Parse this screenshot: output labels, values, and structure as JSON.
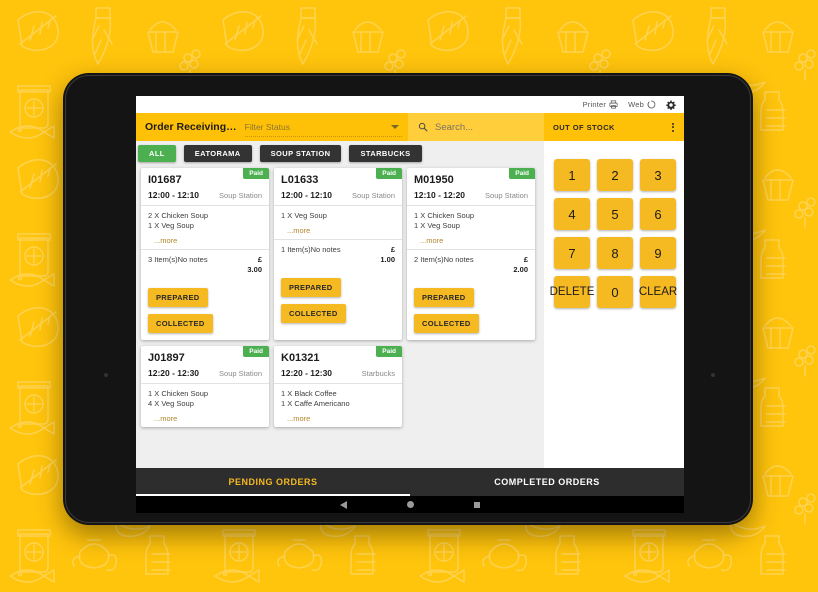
{
  "wallpaper": {
    "bg_color": "#FFC40C",
    "doodle_color": "#FFE08A"
  },
  "device": {
    "frame_color": "#141414"
  },
  "statusbar": {
    "printer_label": "Printer",
    "printer_icon": "printer-icon",
    "web_label": "Web",
    "web_icon": "sync-spinner-icon",
    "settings_icon": "gear-icon"
  },
  "appbar": {
    "title": "Order Receiving…",
    "filter_placeholder": "Filter Status",
    "filter_value": "",
    "dropdown_icon": "chevron-down-icon",
    "accent_color": "#FFC107"
  },
  "search": {
    "placeholder": "Search...",
    "value": "",
    "icon": "search-icon"
  },
  "out_of_stock": {
    "title": "OUT OF STOCK",
    "menu_icon": "kebab-menu-icon",
    "keys": [
      "1",
      "2",
      "3",
      "4",
      "5",
      "6",
      "7",
      "8",
      "9",
      "DELETE",
      "0",
      "CLEAR"
    ],
    "key_color": "#F5B921"
  },
  "filters": {
    "chips": [
      {
        "label": "ALL",
        "active": true
      },
      {
        "label": "EATORAMA",
        "active": false
      },
      {
        "label": "SOUP STATION",
        "active": false
      },
      {
        "label": "STARBUCKS",
        "active": false
      }
    ],
    "active_color": "#4CAF50",
    "inactive_color": "#333333"
  },
  "orders": [
    {
      "id": "I01687",
      "badge": "Paid",
      "time": "12:00 - 12:10",
      "station": "Soup Station",
      "items": [
        "2 X Chicken Soup",
        "1 X Veg Soup"
      ],
      "more_label": "...more",
      "total_note": "3 Item(s)No notes",
      "currency": "£",
      "amount": "3.00",
      "actions": [
        "PREPARED",
        "COLLECTED"
      ]
    },
    {
      "id": "L01633",
      "badge": "Paid",
      "time": "12:00 - 12:10",
      "station": "Soup Station",
      "items": [
        "1 X Veg Soup"
      ],
      "more_label": "...more",
      "total_note": "1 Item(s)No notes",
      "currency": "£",
      "amount": "1.00",
      "actions": [
        "PREPARED",
        "COLLECTED"
      ]
    },
    {
      "id": "M01950",
      "badge": "Paid",
      "time": "12:10 - 12:20",
      "station": "Soup Station",
      "items": [
        "1 X Chicken Soup",
        "1 X Veg Soup"
      ],
      "more_label": "...more",
      "total_note": "2 Item(s)No notes",
      "currency": "£",
      "amount": "2.00",
      "actions": [
        "PREPARED",
        "COLLECTED"
      ]
    },
    {
      "id": "J01897",
      "badge": "Paid",
      "time": "12:20 - 12:30",
      "station": "Soup Station",
      "items": [
        "1 X Chicken Soup",
        "4 X Veg Soup"
      ],
      "more_label": "...more",
      "total_note": "",
      "currency": "",
      "amount": "",
      "actions": []
    },
    {
      "id": "K01321",
      "badge": "Paid",
      "time": "12:20 - 12:30",
      "station": "Starbucks",
      "items": [
        "1 X Black Coffee",
        "1 X Caffe Americano"
      ],
      "more_label": "...more",
      "total_note": "",
      "currency": "",
      "amount": "",
      "actions": []
    }
  ],
  "tabs": [
    {
      "label": "PENDING ORDERS",
      "active": true
    },
    {
      "label": "COMPLETED ORDERS",
      "active": false
    }
  ],
  "navbar": {
    "back_icon": "nav-back-icon",
    "home_icon": "nav-home-icon",
    "recents_icon": "nav-recents-icon"
  }
}
